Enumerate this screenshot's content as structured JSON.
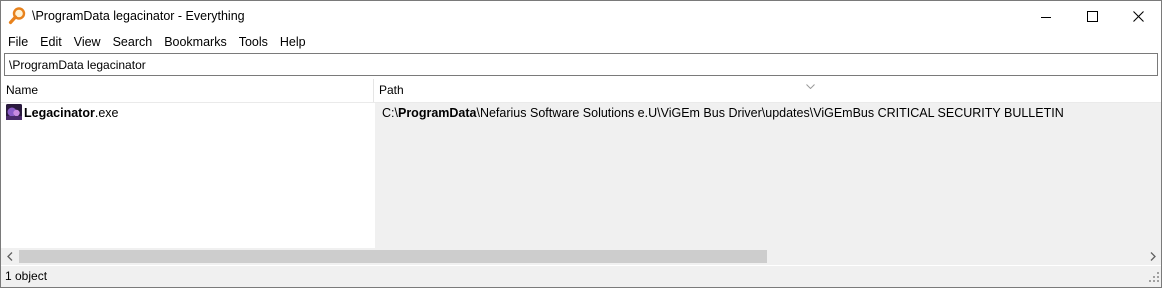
{
  "window": {
    "title": "\\ProgramData legacinator - Everything",
    "app_icon": "magnifier-icon",
    "controls": [
      "minimize-icon",
      "maximize-icon",
      "close-icon"
    ]
  },
  "menu": [
    "File",
    "Edit",
    "View",
    "Search",
    "Bookmarks",
    "Tools",
    "Help"
  ],
  "search": {
    "value": "\\ProgramData legacinator"
  },
  "columns": {
    "name": "Name",
    "path": "Path",
    "sort_indicator": "chevron-down-icon"
  },
  "results": [
    {
      "icon": "executable-icon",
      "name_match": "Legacinator",
      "name_rest": ".exe",
      "path_prefix": "C:\\",
      "path_match": "ProgramData",
      "path_rest": "\\Nefarius Software Solutions e.U\\ViGEm Bus Driver\\updates\\ViGEmBus CRITICAL SECURITY BULLETIN"
    }
  ],
  "status": {
    "text": "1 object"
  },
  "colors": {
    "path_column_bg": "#f0f0f0",
    "border": "#7a7a7a",
    "scrollbar_thumb": "#cdcdcd",
    "app_icon_orange": "#e8821c"
  }
}
